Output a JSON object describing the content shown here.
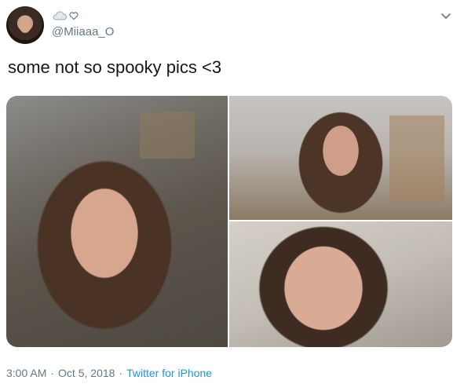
{
  "tweet": {
    "handle": "@Miiaaa_O",
    "text": "some not so spooky pics <3",
    "time": "3:00 AM",
    "date": "Oct 5, 2018",
    "source": "Twitter for iPhone",
    "separator": "·"
  },
  "icons": {
    "display_name_icons": [
      "cloud-icon",
      "heart-icon"
    ],
    "menu": "chevron-down-icon"
  },
  "colors": {
    "text": "#14171a",
    "secondary": "#657786",
    "link": "#1b95e0"
  }
}
